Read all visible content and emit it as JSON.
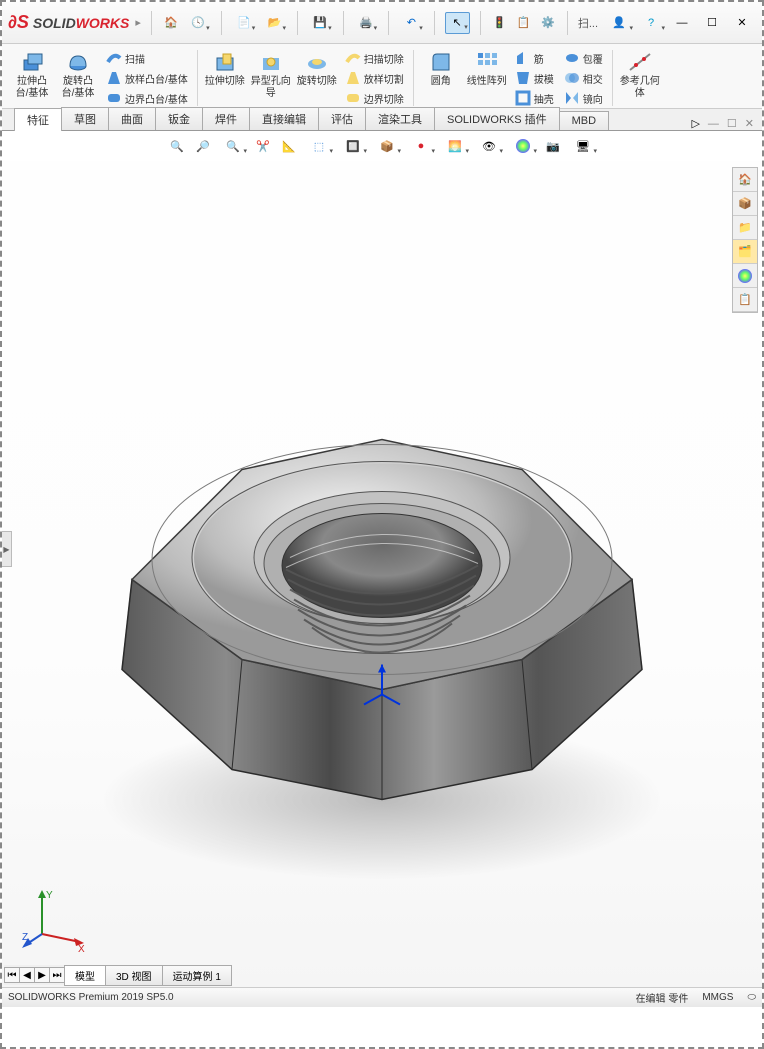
{
  "app": {
    "name_solid": "SOLID",
    "name_works": "WORKS"
  },
  "titlebar": {
    "search_label": "扫..."
  },
  "ribbon": {
    "extrude_boss": "拉伸凸台/基体",
    "revolve_boss": "旋转凸台/基体",
    "sweep": "扫描",
    "loft_boss": "放样凸台/基体",
    "boundary_boss": "边界凸台/基体",
    "extrude_cut": "拉伸切除",
    "hole_wizard": "异型孔向导",
    "revolve_cut": "旋转切除",
    "sweep_cut": "扫描切除",
    "loft_cut": "放样切割",
    "boundary_cut": "边界切除",
    "fillet": "圆角",
    "linear_pattern": "线性阵列",
    "rib": "筋",
    "draft": "拔模",
    "shell": "抽壳",
    "wrap": "包覆",
    "intersect": "相交",
    "mirror": "镜向",
    "ref_geom": "参考几何体"
  },
  "tabs": [
    "特征",
    "草图",
    "曲面",
    "钣金",
    "焊件",
    "直接编辑",
    "评估",
    "渲染工具",
    "SOLIDWORKS 插件",
    "MBD"
  ],
  "bottom_tabs": [
    "模型",
    "3D 视图",
    "运动算例 1"
  ],
  "status": {
    "version": "SOLIDWORKS Premium 2019 SP5.0",
    "mode": "在编辑 零件",
    "units": "MMGS"
  },
  "triad": {
    "x": "X",
    "y": "Y",
    "z": "Z"
  }
}
